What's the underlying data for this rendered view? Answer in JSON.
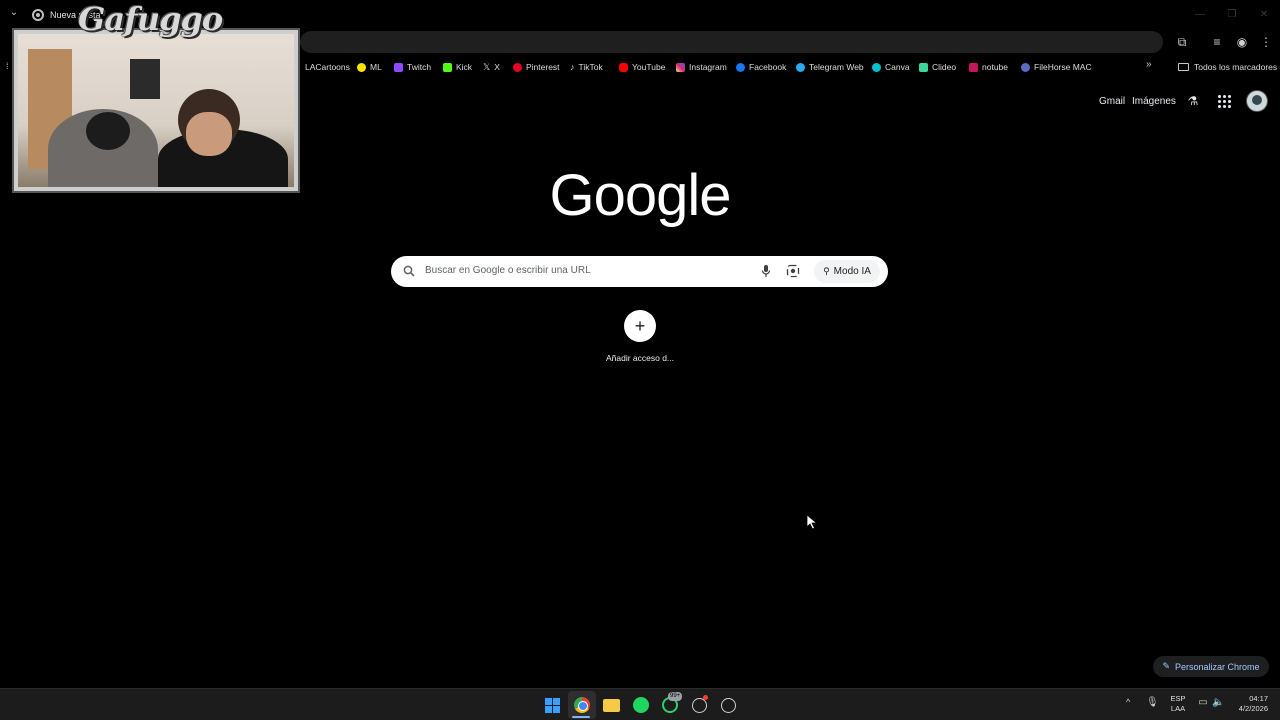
{
  "browser": {
    "tab_title": "Nueva pesta",
    "bookmarks": [
      {
        "label": "LACartoons",
        "color": "#ffffff"
      },
      {
        "label": "ML",
        "color": "#ffe600"
      },
      {
        "label": "Twitch",
        "color": "#9146ff"
      },
      {
        "label": "Kick",
        "color": "#53fc18"
      },
      {
        "label": "X",
        "color": "#ffffff"
      },
      {
        "label": "Pinterest",
        "color": "#e60023"
      },
      {
        "label": "TikTok",
        "color": "#ffffff"
      },
      {
        "label": "YouTube",
        "color": "#ff0000"
      },
      {
        "label": "Instagram",
        "color": "#e1306c"
      },
      {
        "label": "Facebook",
        "color": "#1877f2"
      },
      {
        "label": "Telegram Web",
        "color": "#2aabee"
      },
      {
        "label": "Canva",
        "color": "#00c4cc"
      },
      {
        "label": "Clideo",
        "color": "#3ed598"
      },
      {
        "label": "notube",
        "color": "#c2185b"
      },
      {
        "label": "FileHorse MAC",
        "color": "#5c6bc0"
      }
    ],
    "all_bookmarks_label": "Todos los marcadores"
  },
  "overlay": {
    "logo_text": "Gafuggo"
  },
  "ntp": {
    "gmail_label": "Gmail",
    "images_label": "Imágenes",
    "logo_text": "Google",
    "search_placeholder": "Buscar en Google o escribir una URL",
    "ai_mode_label": "Modo IA",
    "shortcut_label": "Añadir acceso d...",
    "customize_label": "Personalizar Chrome"
  },
  "taskbar": {
    "whatsapp_badge": "99+",
    "lang_line1": "ESP",
    "lang_line2": "LAA",
    "time": "04:17",
    "date": "4/2/2026"
  }
}
